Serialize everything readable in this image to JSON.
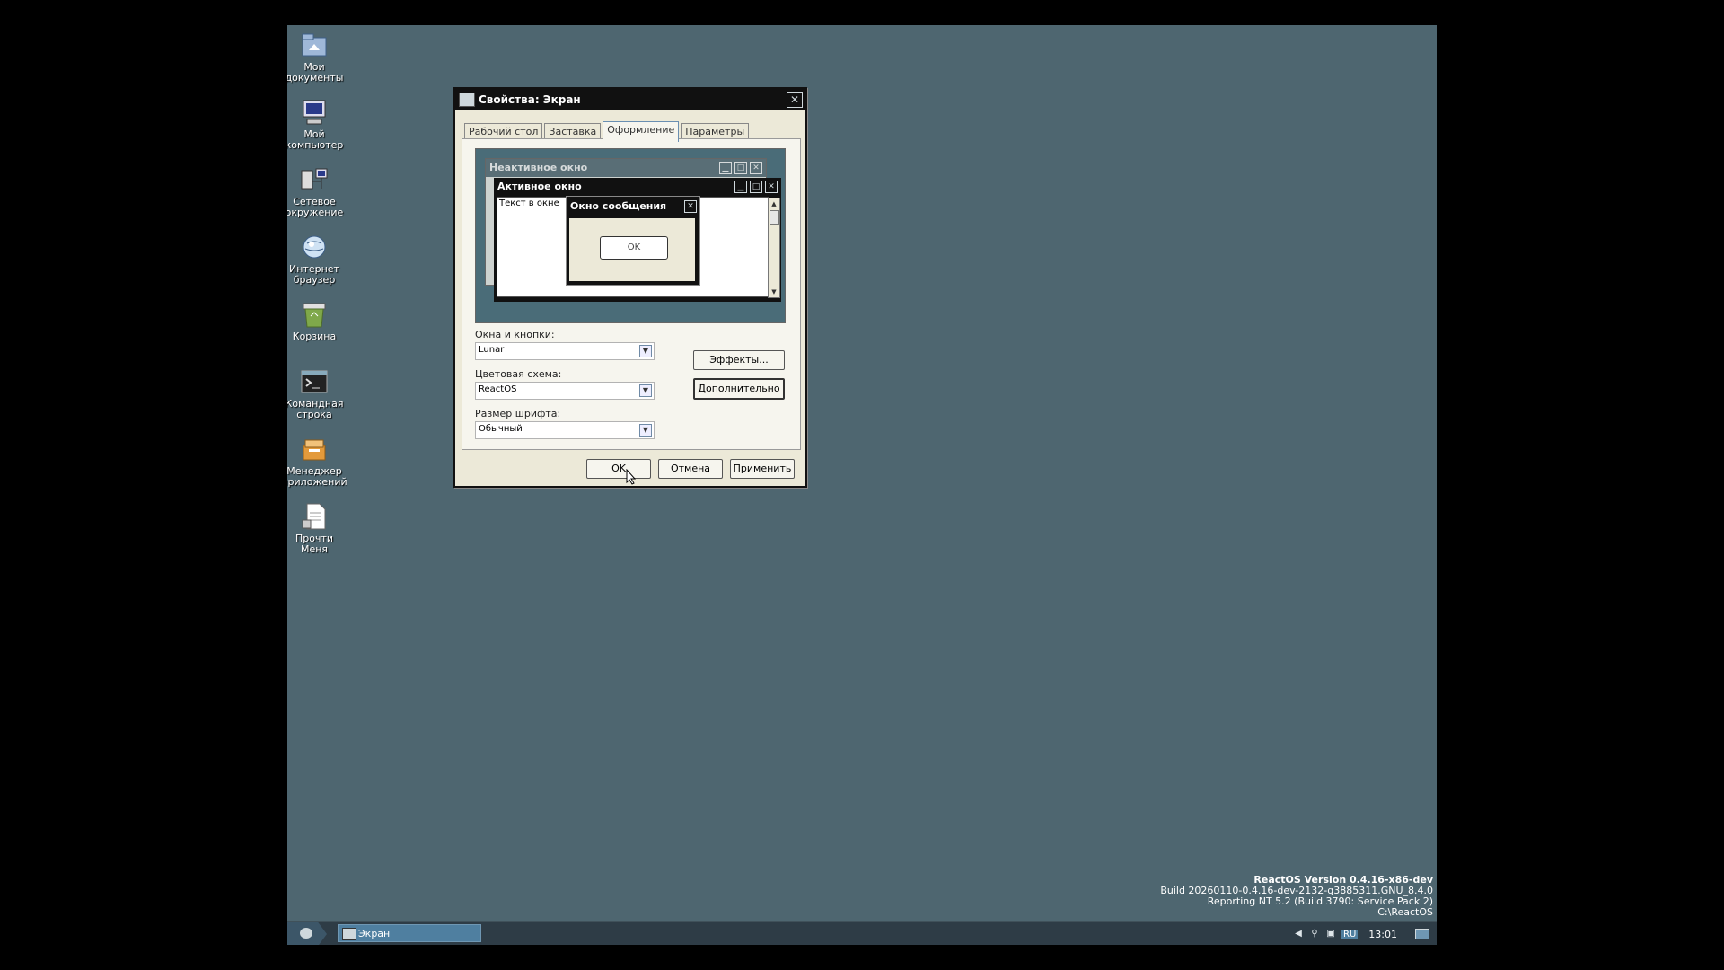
{
  "desktop_icons": [
    {
      "label": "Мои\nдокументы",
      "icon": "my-documents-icon"
    },
    {
      "label": "Мой\nкомпьютер",
      "icon": "my-computer-icon"
    },
    {
      "label": "Сетевое\nокружение",
      "icon": "network-icon"
    },
    {
      "label": "Интернет\nбраузер",
      "icon": "browser-icon"
    },
    {
      "label": "Корзина",
      "icon": "recycle-bin-icon"
    },
    {
      "label": "Командная\nстрока",
      "icon": "command-prompt-icon"
    },
    {
      "label": "Менеджер\nприложений",
      "icon": "app-manager-icon"
    },
    {
      "label": "Прочти\nМеня",
      "icon": "readme-icon"
    }
  ],
  "dialog": {
    "title": "Свойства: Экран",
    "tabs": [
      "Рабочий стол",
      "Заставка",
      "Оформление",
      "Параметры"
    ],
    "active_tab": "Оформление",
    "preview": {
      "inactive_title": "Неактивное окно",
      "active_title": "Активное окно",
      "window_text": "Текст в окне",
      "message_title": "Окно сообщения",
      "message_ok": "OK"
    },
    "windows_buttons_label": "Окна и кнопки:",
    "windows_buttons_value": "Lunar",
    "color_scheme_label": "Цветовая схема:",
    "color_scheme_value": "ReactOS",
    "font_size_label": "Размер шрифта:",
    "font_size_value": "Обычный",
    "effects_button": "Эффекты...",
    "advanced_button": "Дополнительно",
    "ok_button": "OK",
    "cancel_button": "Отмена",
    "apply_button": "Применить"
  },
  "version_info": {
    "line1": "ReactOS Version 0.4.16-x86-dev",
    "line2": "Build 20260110-0.4.16-dev-2132-g3885311.GNU_8.4.0",
    "line3": "Reporting NT 5.2 (Build 3790: Service Pack 2)",
    "line4": "C:\\ReactOS"
  },
  "taskbar": {
    "task_label": "Экран",
    "language": "RU",
    "clock": "13:01"
  },
  "colors": {
    "desktop": "#4e6670",
    "taskbar": "#2e3c46",
    "dialog_bg": "#ece9d8",
    "titlebar": "#111111"
  }
}
